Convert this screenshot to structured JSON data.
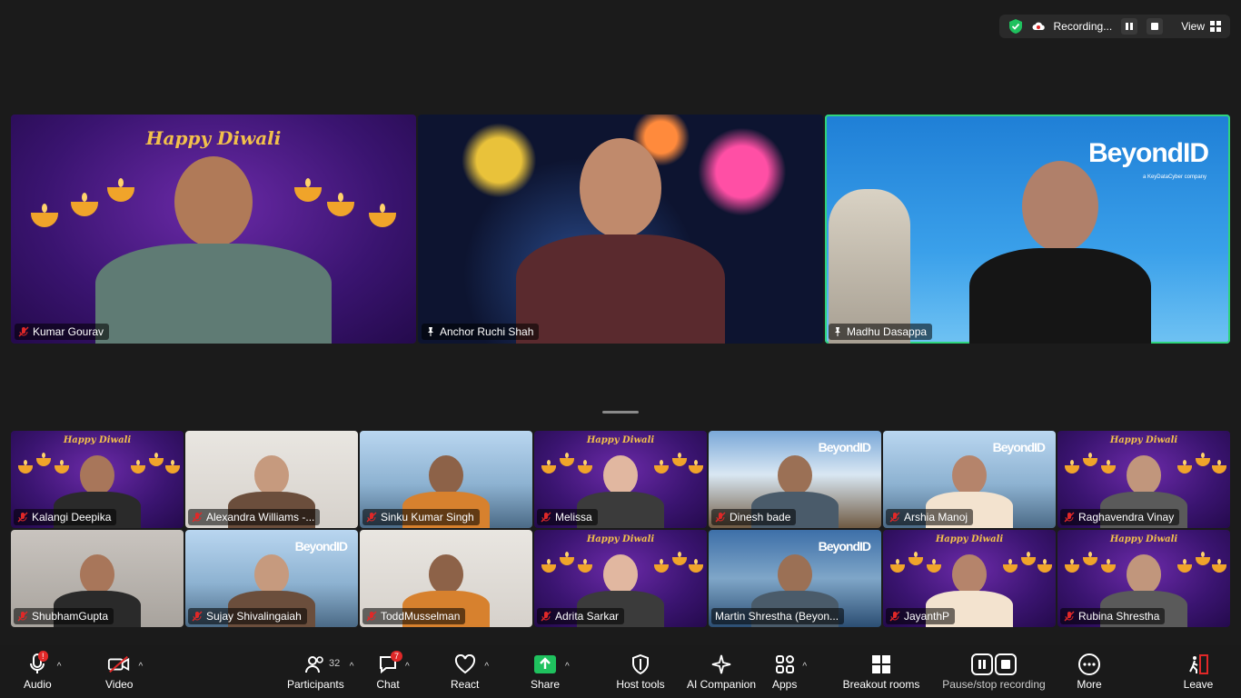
{
  "status_bar": {
    "recording_label": "Recording...",
    "view_label": "View"
  },
  "featured": [
    {
      "name": "Kumar Gourav",
      "muted": true,
      "pinned": false,
      "background": "diwali",
      "bg_title": "Happy Diwali",
      "active": false
    },
    {
      "name": "Anchor Ruchi Shah",
      "muted": false,
      "pinned": true,
      "background": "fireworks",
      "active": false
    },
    {
      "name": "Madhu Dasappa",
      "muted": false,
      "pinned": true,
      "background": "beyondid-sky",
      "bg_logo": "BeyondID",
      "bg_logo_sub": "a KeyDataCyber company",
      "active": true
    }
  ],
  "gallery": [
    {
      "name": "Kalangi Deepika",
      "muted": true,
      "background": "diwali",
      "bg_title": "Happy Diwali"
    },
    {
      "name": "Alexandra Williams -...",
      "muted": true,
      "background": "office"
    },
    {
      "name": "Sinku Kumar Singh",
      "muted": true,
      "background": "city"
    },
    {
      "name": "Melissa",
      "muted": true,
      "background": "diwali",
      "bg_title": "Happy Diwali"
    },
    {
      "name": "Dinesh bade",
      "muted": true,
      "background": "mountain",
      "bg_logo": "BeyondID"
    },
    {
      "name": "Arshia Manoj",
      "muted": true,
      "background": "city",
      "bg_logo": "BeyondID"
    },
    {
      "name": "Raghavendra Vinay",
      "muted": true,
      "background": "diwali",
      "bg_title": "Happy Diwali"
    },
    {
      "name": "ShubhamGupta",
      "muted": true,
      "background": "gray"
    },
    {
      "name": "Sujay Shivalingaiah",
      "muted": true,
      "background": "city",
      "bg_logo": "BeyondID"
    },
    {
      "name": "ToddMusselman",
      "muted": true,
      "background": "office"
    },
    {
      "name": "Adrita Sarkar",
      "muted": true,
      "background": "diwali",
      "bg_title": "Happy Diwali"
    },
    {
      "name": "Martin Shrestha (Beyon...",
      "muted": false,
      "background": "bridge",
      "bg_logo": "BeyondID"
    },
    {
      "name": "JayanthP",
      "muted": true,
      "background": "diwali",
      "bg_title": "Happy Diwali"
    },
    {
      "name": "Rubina Shrestha",
      "muted": true,
      "background": "diwali",
      "bg_title": "Happy Diwali"
    }
  ],
  "toolbar": {
    "audio": {
      "label": "Audio",
      "badge": "!"
    },
    "video": {
      "label": "Video"
    },
    "participants": {
      "label": "Participants",
      "count": "32"
    },
    "chat": {
      "label": "Chat",
      "badge": "7"
    },
    "react": {
      "label": "React"
    },
    "share": {
      "label": "Share"
    },
    "host_tools": {
      "label": "Host tools"
    },
    "ai_companion": {
      "label": "AI Companion"
    },
    "apps": {
      "label": "Apps"
    },
    "breakout": {
      "label": "Breakout rooms"
    },
    "recording": {
      "label": "Pause/stop recording"
    },
    "more": {
      "label": "More"
    },
    "leave": {
      "label": "Leave"
    }
  },
  "colors": {
    "active_speaker": "#2fd47c",
    "share_green": "#1fc15e",
    "leave_red": "#e02828",
    "shield_green": "#1fc15e"
  }
}
